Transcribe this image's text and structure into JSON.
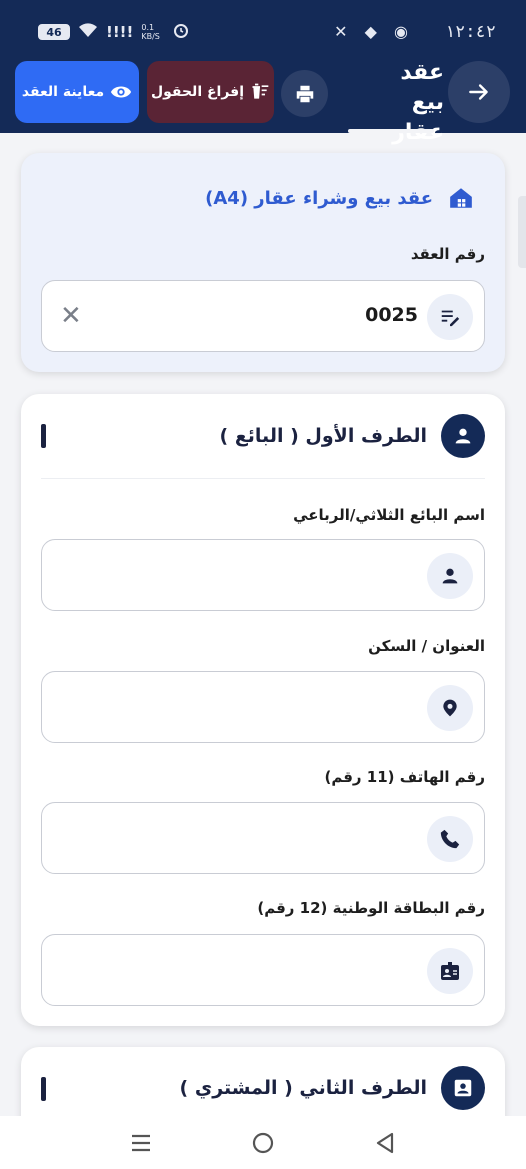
{
  "status": {
    "time": "١٢:٤٢",
    "battery": "46",
    "speed": "0.1 KB/S"
  },
  "header": {
    "title": "عقد بيع عقار",
    "clear_label": "إفراغ الحقول",
    "preview_label": "معاينة العقد"
  },
  "contract": {
    "heading": "عقد بيع وشراء عقار (A4)",
    "number_label": "رقم العقد",
    "number_value": "0025"
  },
  "seller": {
    "heading": "الطرف الأول ( البائع )",
    "name_label": "اسم البائع الثلاثي/الرباعي",
    "address_label": "العنوان / السكن",
    "phone_label": "رقم الهاتف (11 رقم)",
    "id_label": "رقم البطاقة الوطنية (12 رقم)"
  },
  "buyer": {
    "heading": "الطرف الثاني ( المشتري )"
  },
  "colors": {
    "header_bg": "#142a57",
    "preview_btn": "#2f6bf4",
    "clear_btn": "#5a2435",
    "accent_title": "#2f5bd0"
  },
  "icons": {
    "back": "arrow-right-icon",
    "print": "printer-icon",
    "clear": "delete-sweep-icon",
    "preview": "eye-icon",
    "contract": "house-icon",
    "edit": "edit-note-icon",
    "person": "person-icon",
    "location": "location-pin-icon",
    "phone": "phone-icon",
    "id_card": "id-badge-icon",
    "buyer": "account-box-icon"
  }
}
